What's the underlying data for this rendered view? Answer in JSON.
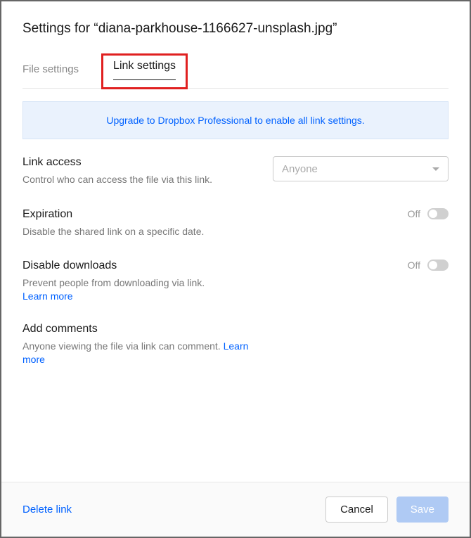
{
  "title": "Settings for “diana-parkhouse-1166627-unsplash.jpg”",
  "tabs": {
    "file_settings": "File settings",
    "link_settings": "Link settings"
  },
  "upgrade_banner": "Upgrade to Dropbox Professional to enable all link settings.",
  "link_access": {
    "title": "Link access",
    "desc": "Control who can access the file via this link.",
    "selected": "Anyone"
  },
  "expiration": {
    "title": "Expiration",
    "desc": "Disable the shared link on a specific date.",
    "state": "Off"
  },
  "disable_downloads": {
    "title": "Disable downloads",
    "desc": "Prevent people from downloading via link.",
    "learn_more": "Learn more",
    "state": "Off"
  },
  "add_comments": {
    "title": "Add comments",
    "desc": "Anyone viewing the file via link can comment. ",
    "learn_more": "Learn more"
  },
  "footer": {
    "delete_link": "Delete link",
    "cancel": "Cancel",
    "save": "Save"
  }
}
